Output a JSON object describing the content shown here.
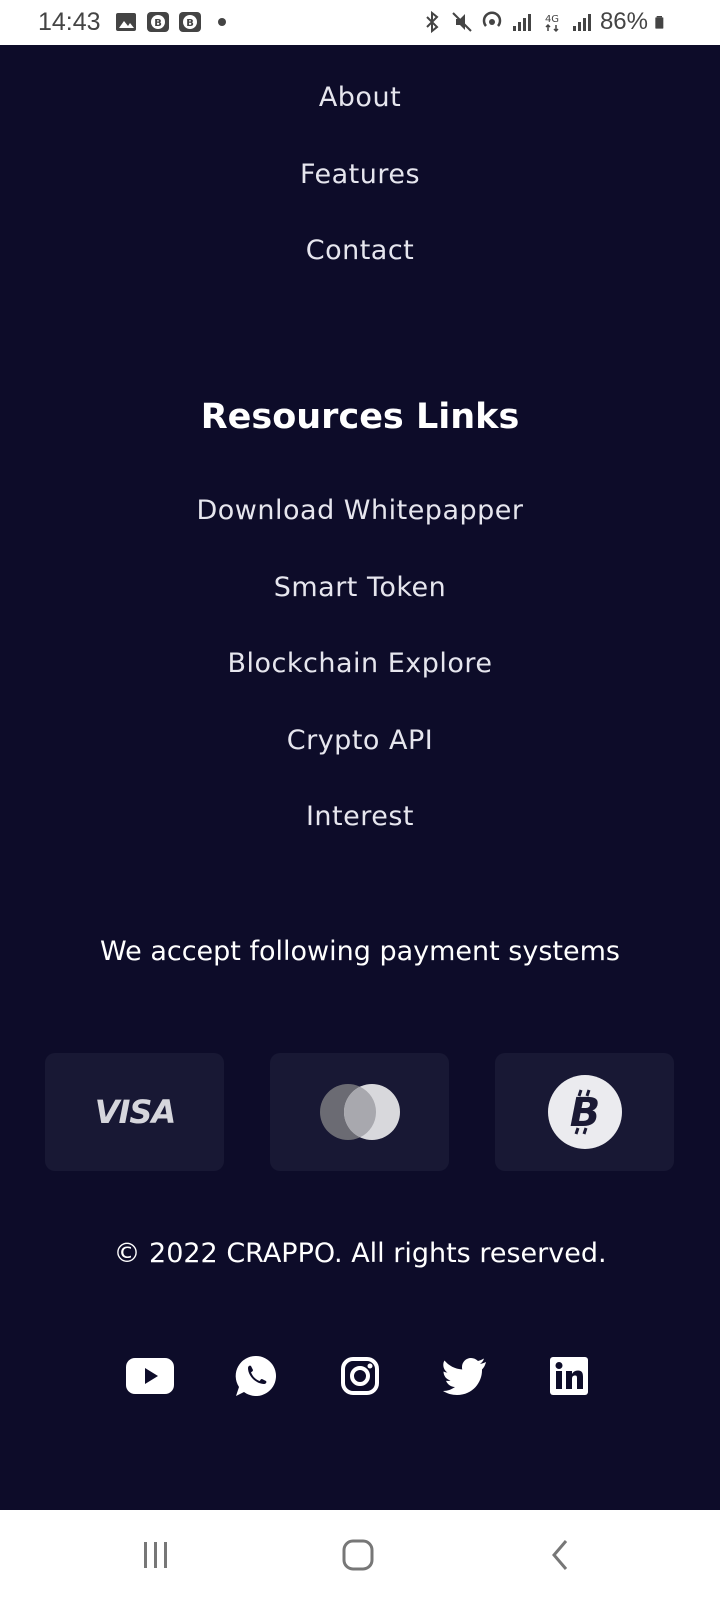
{
  "status_bar": {
    "time": "14:43",
    "battery": "86%",
    "icons_left": [
      "gallery-icon",
      "app-b-icon",
      "app-b-icon",
      "dot-icon"
    ],
    "icons_right": [
      "bluetooth-icon",
      "mute-icon",
      "hotspot-icon",
      "signal-icon",
      "4g-icon",
      "signal-icon",
      "battery-icon"
    ]
  },
  "menu_links": [
    "About",
    "Features",
    "Contact"
  ],
  "resources": {
    "heading": "Resources Links",
    "links": [
      "Download Whitepapper",
      "Smart Token",
      "Blockchain Explore",
      "Crypto API",
      "Interest"
    ]
  },
  "payments": {
    "title": "We accept following payment systems",
    "methods": [
      {
        "name": "VISA",
        "icon": "visa-logo"
      },
      {
        "name": "Mastercard",
        "icon": "mastercard-logo"
      },
      {
        "name": "Bitcoin",
        "icon": "bitcoin-logo"
      }
    ]
  },
  "copyright": "© 2022 CRAPPO. All rights reserved.",
  "socials": [
    "youtube-icon",
    "whatsapp-icon",
    "instagram-icon",
    "twitter-icon",
    "linkedin-icon"
  ],
  "colors": {
    "background": "#0d0c29",
    "card": "#181834",
    "text": "#e6e6ee"
  }
}
